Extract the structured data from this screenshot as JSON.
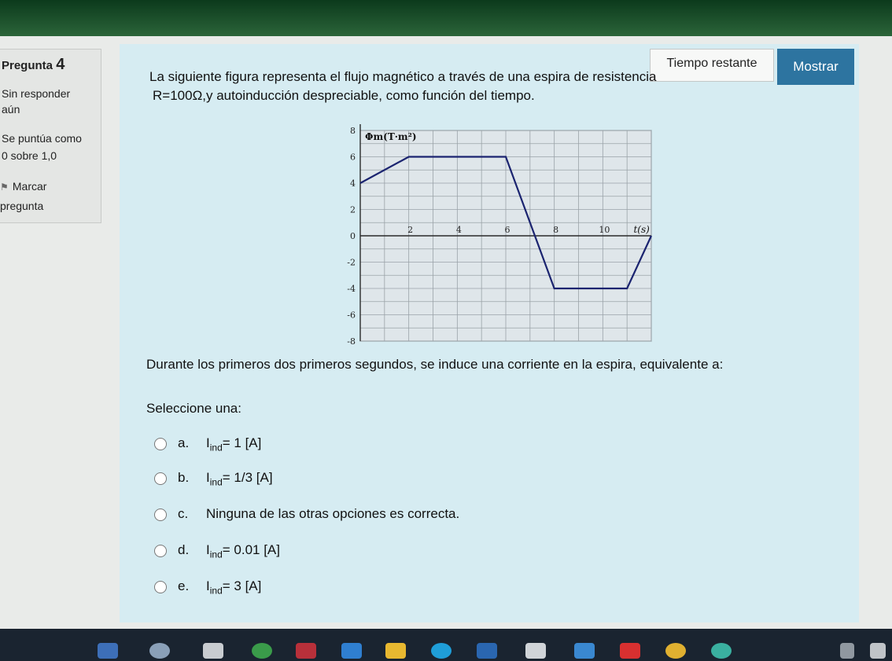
{
  "question_info": {
    "label": "Pregunta",
    "number": "4",
    "state_line1": "Sin responder",
    "state_line2": "aún",
    "score_line1": "Se puntúa como",
    "score_line2": "0 sobre 1,0",
    "flag_line1": "Marcar",
    "flag_line2": "pregunta",
    "flag_icon": "flag-icon"
  },
  "timer": {
    "label": "Tiempo restante",
    "button": "Mostrar"
  },
  "question": {
    "line1": "La siguiente figura representa el flujo magnético a través de una espira de resistencia",
    "line2": "R=100Ω,y autoinducción despreciable, como función del tiempo.",
    "prompt": "Durante los primeros dos primeros segundos, se induce una corriente en la espira, equivalente a:",
    "select_label": "Seleccione una:"
  },
  "options": [
    {
      "letter": "a.",
      "pre": "I",
      "sub": "ind",
      "post": "= 1 [A]"
    },
    {
      "letter": "b.",
      "pre": "I",
      "sub": "ind",
      "post": "=  1/3 [A]"
    },
    {
      "letter": "c.",
      "pre": "",
      "sub": "",
      "post": "Ninguna de las otras opciones es correcta."
    },
    {
      "letter": "d.",
      "pre": "I",
      "sub": "ind",
      "post": "= 0.01 [A]"
    },
    {
      "letter": "e.",
      "pre": "I",
      "sub": "ind",
      "post": "= 3 [A]"
    }
  ],
  "chart_data": {
    "type": "line",
    "ylabel": "Φm(T·m²)",
    "xlabel": "t(s)",
    "x_ticks": [
      "2",
      "4",
      "6",
      "8",
      "10"
    ],
    "y_ticks": [
      "8",
      "6",
      "4",
      "2",
      "0",
      "-2",
      "-4",
      "-6",
      "-8"
    ],
    "xlim": [
      0,
      12
    ],
    "ylim": [
      -8,
      8
    ],
    "grid": true,
    "series": [
      {
        "x": [
          0,
          2,
          6,
          8,
          11,
          12
        ],
        "y": [
          4,
          6,
          6,
          -4,
          -4,
          0
        ],
        "color": "#1b2470"
      }
    ]
  }
}
